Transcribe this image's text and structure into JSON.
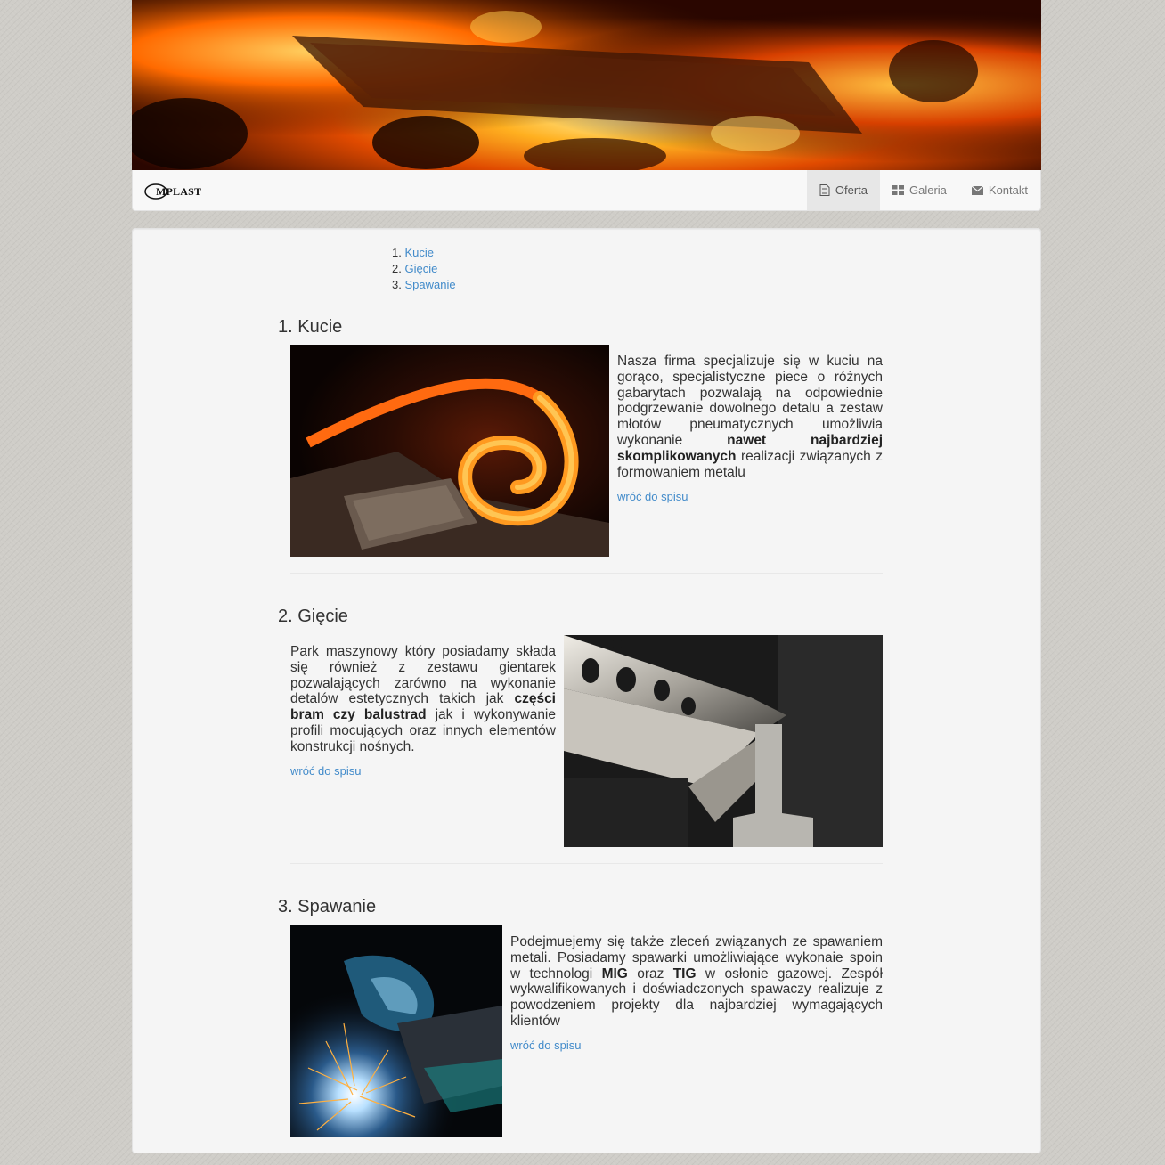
{
  "navbar": {
    "brand": "MPLAST",
    "items": [
      {
        "label": "Oferta",
        "icon": "file-icon",
        "active": true
      },
      {
        "label": "Galeria",
        "icon": "grid-icon",
        "active": false
      },
      {
        "label": "Kontakt",
        "icon": "envelope-icon",
        "active": false
      }
    ]
  },
  "toc": [
    {
      "number": "1.",
      "label": "Kucie"
    },
    {
      "number": "2.",
      "label": "Gięcie"
    },
    {
      "number": "3.",
      "label": "Spawanie"
    }
  ],
  "sections": [
    {
      "title": "1. Kucie",
      "text_parts": [
        "Nasza firma specjalizuje się w kuciu na gorąco, specjalistyczne piece o różnych gabarytach pozwalają na odpowiednie podgrzewanie dowolnego detalu a zestaw młotów pneumatycznych umożliwia wykonanie ",
        "nawet najbardziej skomplikowanych",
        " realizacji związanych z formowaniem metalu"
      ],
      "back_link": "wróć do spisu"
    },
    {
      "title": "2. Gięcie",
      "text_parts": [
        "Park maszynowy który posiadamy składa się również z zestawu gientarek pozwalających zarówno na wykonanie detalów estetycznych takich jak ",
        "części bram czy balustrad",
        " jak i wykonywanie profili mocujących oraz innych elementów konstrukcji nośnych."
      ],
      "back_link": "wróć do spisu"
    },
    {
      "title": "3. Spawanie",
      "text_parts": [
        "Podejmuejemy się także zleceń związanych ze spawaniem metali. Posiadamy spawarki umożliwiające wykonaie spoin w technologi ",
        "MIG",
        " oraz ",
        "TIG",
        " w osłonie gazowej. Zespół wykwalifikowanych i doświadczonych spawaczy realizuje z powodzeniem projekty dla najbardziej wymagających klientów"
      ],
      "back_link": "wróć do spisu"
    }
  ],
  "colors": {
    "link": "#428bca",
    "background": "#cfcdc8",
    "panel": "#f5f5f5"
  }
}
